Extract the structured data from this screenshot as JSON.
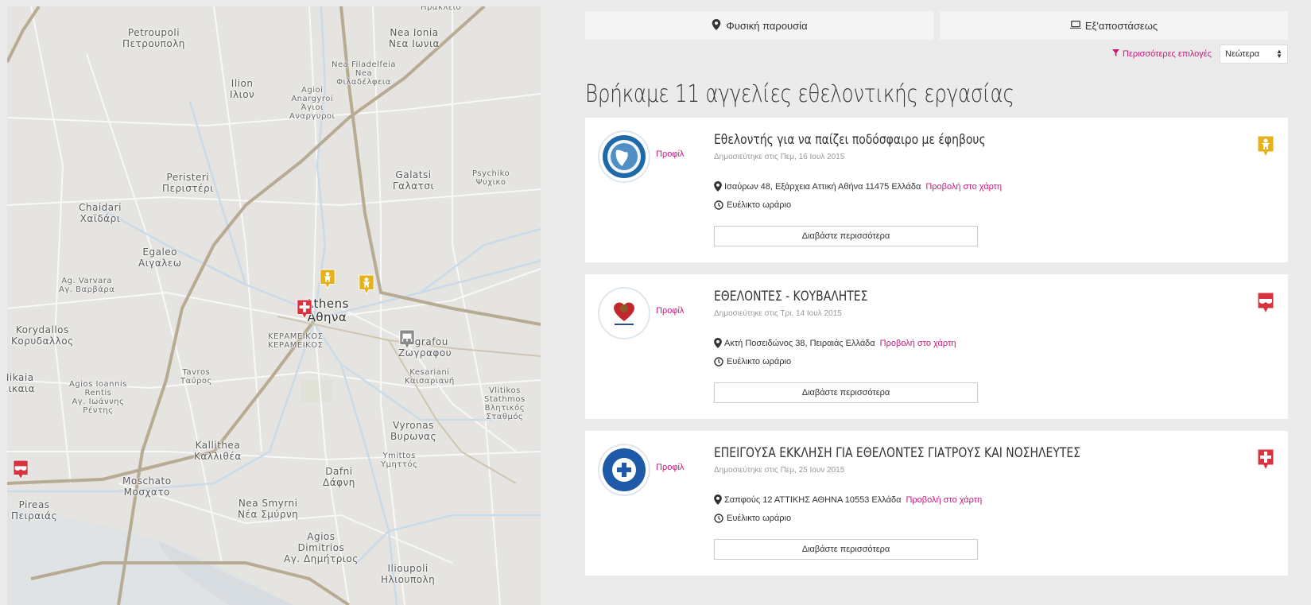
{
  "tabs": {
    "physical": "Φυσική παρουσία",
    "remote": "Εξ'αποστάσεως"
  },
  "filters": {
    "more_options": "Περισσότερες επιλογές",
    "sort_selected": "Νεώτερα"
  },
  "heading": "Βρήκαμε 11 αγγελίες εθελοντικής εργασίας",
  "listings": [
    {
      "title": "Εθελοντής για να παίζει ποδόσφαιρο με έφηβους",
      "profile": "Προφίλ",
      "date": "Δημοσιεύτηκε στις Πεμ, 16 Ιουλ 2015",
      "address": "Ισαύρων 48, Εξάρχεια Αττική Αθήνα 11475 Ελλάδα",
      "map_link": "Προβολή στο χάρτη",
      "schedule": "Ευέλικτο ωράριο",
      "read_more": "Διαβάστε περισσότερα",
      "category_color": "#e5b21a",
      "category_icon": "child-icon"
    },
    {
      "title": "ΕΘΕΛΟΝΤΕΣ - ΚΟΥΒΑΛΗΤΕΣ",
      "profile": "Προφίλ",
      "date": "Δημοσιεύτηκε στις Τρι, 14 Ιουλ 2015",
      "address": "Ακτή Ποσειδώνος 38, Πειραιάς Ελλάδα",
      "map_link": "Προβολή στο χάρτη",
      "schedule": "Ευέλικτο ωράριο",
      "read_more": "Διαβάστε περισσότερα",
      "category_color": "#d9333f",
      "category_icon": "hands-icon"
    },
    {
      "title": "ΕΠΕΙΓΟΥΣΑ ΕΚΚΛΗΣΗ ΓΙΑ ΕΘΕΛΟΝΤΕΣ ΓΙΑΤΡΟΥΣ ΚΑΙ ΝΟΣΗΛΕΥΤΕΣ",
      "profile": "Προφίλ",
      "date": "Δημοσιεύτηκε στις Πεμ, 25 Ιουν 2015",
      "address": "Σαπφούς 12 ΑΤΤΙΚΗΣ ΑΘΗΝΑ 10553 Ελλάδα",
      "map_link": "Προβολή στο χάρτη",
      "schedule": "Ευέλικτο ωράριο",
      "read_more": "Διαβάστε περισσότερα",
      "category_color": "#d9333f",
      "category_icon": "medical-cross-icon"
    }
  ],
  "map": {
    "labels": [
      {
        "text": "Ηρακλειο",
        "cls": "small"
      },
      {
        "text": "Petroupoli\nΠετρουπολη",
        "cls": ""
      },
      {
        "text": "Nea Ionia\nΝεα Ιωνια",
        "cls": ""
      },
      {
        "text": "Nea Filadelfeia\nNea\nΦιλαδέλφεια",
        "cls": "small"
      },
      {
        "text": "Ilion\nΙλιον",
        "cls": ""
      },
      {
        "text": "Agioi\nAnargyroi\nΆγιοι\nΑναργυροι",
        "cls": "small"
      },
      {
        "text": "Peristeri\nΠεριστέρι",
        "cls": ""
      },
      {
        "text": "Galatsi\nΓαλατσι",
        "cls": ""
      },
      {
        "text": "Psychiko\nΨυχικο",
        "cls": "small"
      },
      {
        "text": "Chaidari\nΧαϊδάρι",
        "cls": ""
      },
      {
        "text": "Egaleo\nΑιγαλεω",
        "cls": ""
      },
      {
        "text": "Ag. Varvara\nΑγ. Βαρβάρα",
        "cls": "small"
      },
      {
        "text": "Athens\nΑθηνα",
        "cls": "big"
      },
      {
        "text": "Korydallos\nΚορυδαλλος",
        "cls": ""
      },
      {
        "text": "Zografou\nΖωγραφου",
        "cls": ""
      },
      {
        "text": "Nikaia\nΝικαια",
        "cls": ""
      },
      {
        "text": "Agios Ioannis\nRentis\nΑγ. Ιωάννης\nΡέντης",
        "cls": "small"
      },
      {
        "text": "Tavros\nΤαύρος",
        "cls": "small"
      },
      {
        "text": "Kesariani\nΚαισαριανή",
        "cls": "small"
      },
      {
        "text": "Vyronas\nΒυρωνας",
        "cls": ""
      },
      {
        "text": "Vlitikos\nStathmos\nΒλητικός\nΣταθμός",
        "cls": "small"
      },
      {
        "text": "Kallithea\nΚαλλιθέα",
        "cls": ""
      },
      {
        "text": "Ymittos\nΥμηττός",
        "cls": "small"
      },
      {
        "text": "Dafni\nΔάφνη",
        "cls": ""
      },
      {
        "text": "Moschato\nΜοσχατο",
        "cls": ""
      },
      {
        "text": "Pireas\nΠειραιάς",
        "cls": ""
      },
      {
        "text": "Nea Smyrni\nΝέα Σμύρνη",
        "cls": ""
      },
      {
        "text": "Agios\nDimitrios\nΑγ. Δημήτριος",
        "cls": ""
      },
      {
        "text": "Ilioupoli\nΗλιουπολη",
        "cls": ""
      },
      {
        "text": "ΚΕΡΑΜΕΙΚΟΣ\nΚΕΡΑΜΕΙΚΟΣ",
        "cls": "small"
      }
    ],
    "markers": [
      {
        "type": "child-icon",
        "color": "#e5b21a"
      },
      {
        "type": "child-icon",
        "color": "#e5b21a"
      },
      {
        "type": "medical-cross-icon",
        "color": "#d9333f"
      },
      {
        "type": "group-icon",
        "color": "#8a8a8a"
      },
      {
        "type": "hands-icon",
        "color": "#d9333f"
      }
    ]
  }
}
